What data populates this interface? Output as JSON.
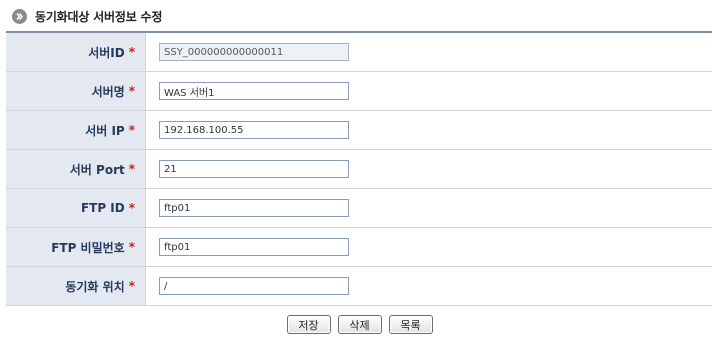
{
  "header": {
    "icon": "chevron-right-circle-icon",
    "title": "동기화대상 서버정보 수정"
  },
  "form": {
    "required_mark": "*",
    "fields": [
      {
        "label": "서버ID",
        "value": "SSY_000000000000011",
        "readonly": true
      },
      {
        "label": "서버명",
        "value": "WAS 서버1"
      },
      {
        "label": "서버 IP",
        "value": "192.168.100.55"
      },
      {
        "label": "서버 Port",
        "value": "21"
      },
      {
        "label": "FTP ID",
        "value": "ftp01"
      },
      {
        "label": "FTP 비밀번호",
        "value": "ftp01"
      },
      {
        "label": "동기화 위치",
        "value": "/"
      }
    ]
  },
  "buttons": {
    "save": "저장",
    "delete": "삭제",
    "list": "목록"
  },
  "colors": {
    "label_bg": "#e4e8f1",
    "label_text": "#263a5c",
    "required": "#d41a1a",
    "table_top_border": "#7e8fa8"
  }
}
